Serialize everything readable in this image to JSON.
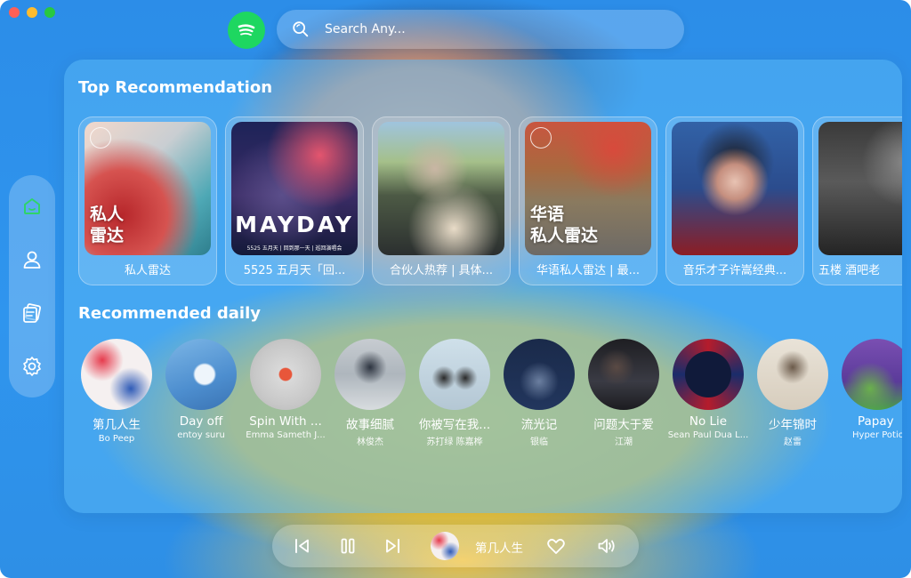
{
  "window": {
    "traffic_lights": [
      "#fe5f57",
      "#febc2e",
      "#28c840"
    ]
  },
  "header": {
    "logo": "spotify-logo",
    "search_placeholder": "Search Any..."
  },
  "sidebar": {
    "items": [
      {
        "name": "home",
        "icon": "home-icon",
        "active": true
      },
      {
        "name": "profile",
        "icon": "user-icon"
      },
      {
        "name": "library",
        "icon": "cards-icon"
      },
      {
        "name": "settings",
        "icon": "gear-icon"
      }
    ]
  },
  "top_recommendation": {
    "title": "Top Recommendation",
    "cards": [
      {
        "title": "私人雷达",
        "cover_text": "私人\n雷达"
      },
      {
        "title": "5525 五月天「回...",
        "cover_text": "MAYDAY",
        "cover_caption": "5525 五月天 | 回到那一天 | 巡回演唱会"
      },
      {
        "title": "合伙人热荐 | 具体..."
      },
      {
        "title": "华语私人雷达 | 最...",
        "cover_text": "华语\n私人雷达"
      },
      {
        "title": "音乐才子许嵩经典..."
      },
      {
        "title": "五楼 酒吧老"
      }
    ]
  },
  "recommended_daily": {
    "title": "Recommended daily",
    "songs": [
      {
        "title": "第几人生",
        "artist": "Bo Peep"
      },
      {
        "title": "Day off",
        "artist": "entoy suru"
      },
      {
        "title": "Spin With ...",
        "artist": "Emma Sameth J..."
      },
      {
        "title": "故事细腻",
        "artist": "林俊杰"
      },
      {
        "title": "你被写在我...",
        "artist": "苏打绿 陈嘉桦"
      },
      {
        "title": "流光记",
        "artist": "银临"
      },
      {
        "title": "问题大于爱",
        "artist": "江潮"
      },
      {
        "title": "No Lie",
        "artist": "Sean Paul Dua L..."
      },
      {
        "title": "少年锦时",
        "artist": "赵雷"
      },
      {
        "title": "Papay",
        "artist": "Hyper Potio"
      }
    ]
  },
  "player": {
    "now_playing": "第几人生",
    "controls": [
      "previous-icon",
      "pause-icon",
      "next-icon",
      "heart-icon",
      "volume-icon"
    ]
  }
}
